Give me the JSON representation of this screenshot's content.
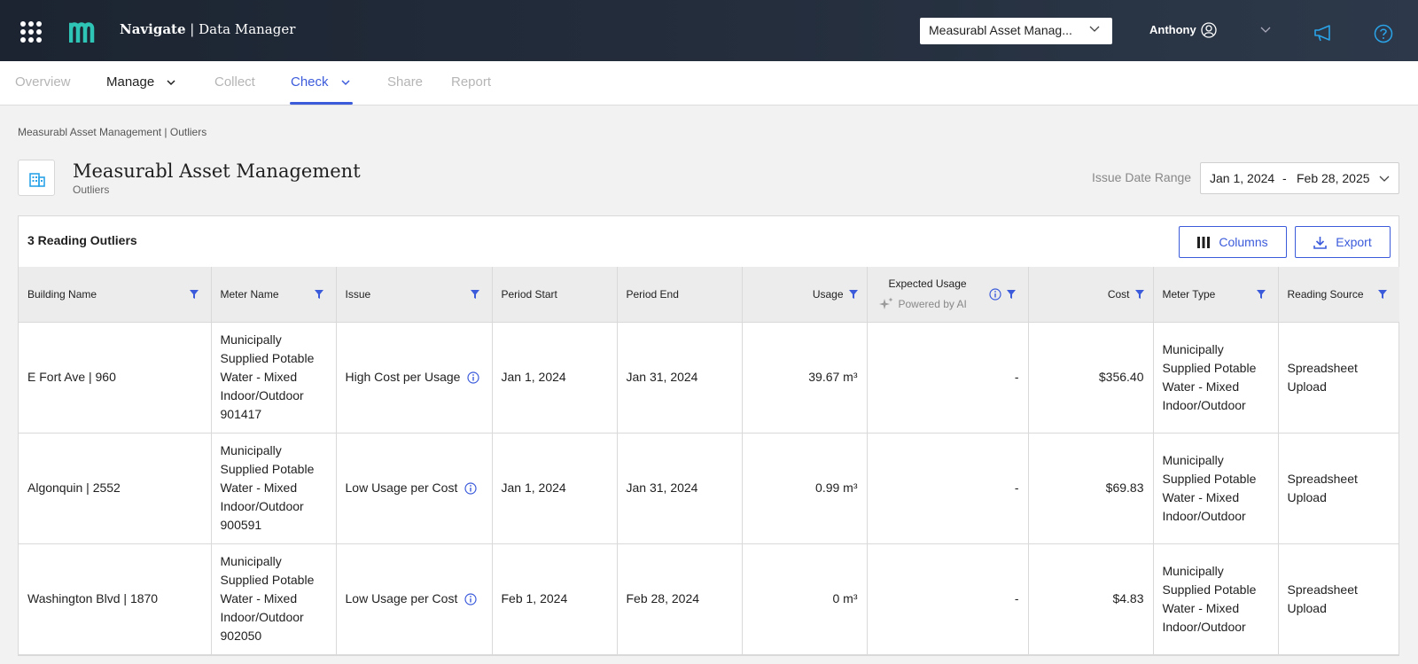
{
  "header": {
    "brand_bold": "Navigate",
    "brand_rest": " | Data Manager",
    "org_select": "Measurabl Asset Manag...",
    "user_name": "Anthony"
  },
  "nav": {
    "tabs": [
      {
        "label": "Overview"
      },
      {
        "label": "Manage"
      },
      {
        "label": "Collect"
      },
      {
        "label": "Check"
      },
      {
        "label": "Share"
      },
      {
        "label": "Report"
      }
    ]
  },
  "page": {
    "breadcrumb": "Measurabl Asset Management | Outliers",
    "title": "Measurabl Asset Management",
    "subtitle": "Outliers",
    "range_label": "Issue Date Range",
    "range_start": "Jan 1, 2024",
    "range_sep": "-",
    "range_end": "Feb 28, 2025"
  },
  "table": {
    "title": "3 Reading Outliers",
    "columns_btn": "Columns",
    "export_btn": "Export",
    "headers": {
      "building": "Building Name",
      "meter": "Meter Name",
      "issue": "Issue",
      "period_start": "Period Start",
      "period_end": "Period End",
      "usage": "Usage",
      "expected": "Expected Usage",
      "powered": "Powered by AI",
      "cost": "Cost",
      "meter_type": "Meter Type",
      "source": "Reading Source"
    },
    "rows": [
      {
        "building": "E Fort Ave | 960",
        "meter": "Municipally Supplied Potable Water - Mixed Indoor/Outdoor 901417",
        "issue": "High Cost per Usage",
        "period_start": "Jan 1, 2024",
        "period_end": "Jan 31, 2024",
        "usage": "39.67 m³",
        "expected": "-",
        "cost": "$356.40",
        "meter_type": "Municipally Supplied Potable Water - Mixed Indoor/Outdoor",
        "source": "Spreadsheet Upload"
      },
      {
        "building": "Algonquin | 2552",
        "meter": "Municipally Supplied Potable Water - Mixed Indoor/Outdoor 900591",
        "issue": "Low Usage per Cost",
        "period_start": "Jan 1, 2024",
        "period_end": "Jan 31, 2024",
        "usage": "0.99 m³",
        "expected": "-",
        "cost": "$69.83",
        "meter_type": "Municipally Supplied Potable Water - Mixed Indoor/Outdoor",
        "source": "Spreadsheet Upload"
      },
      {
        "building": "Washington Blvd | 1870",
        "meter": "Municipally Supplied Potable Water - Mixed Indoor/Outdoor 902050",
        "issue": "Low Usage per Cost",
        "period_start": "Feb 1, 2024",
        "period_end": "Feb 28, 2024",
        "usage": "0 m³",
        "expected": "-",
        "cost": "$4.83",
        "meter_type": "Municipally Supplied Potable Water - Mixed Indoor/Outdoor",
        "source": "Spreadsheet Upload"
      }
    ]
  },
  "colors": {
    "accent": "#3b5bdb",
    "logo": "#2ec4b6",
    "topbar": "#1c2431"
  }
}
